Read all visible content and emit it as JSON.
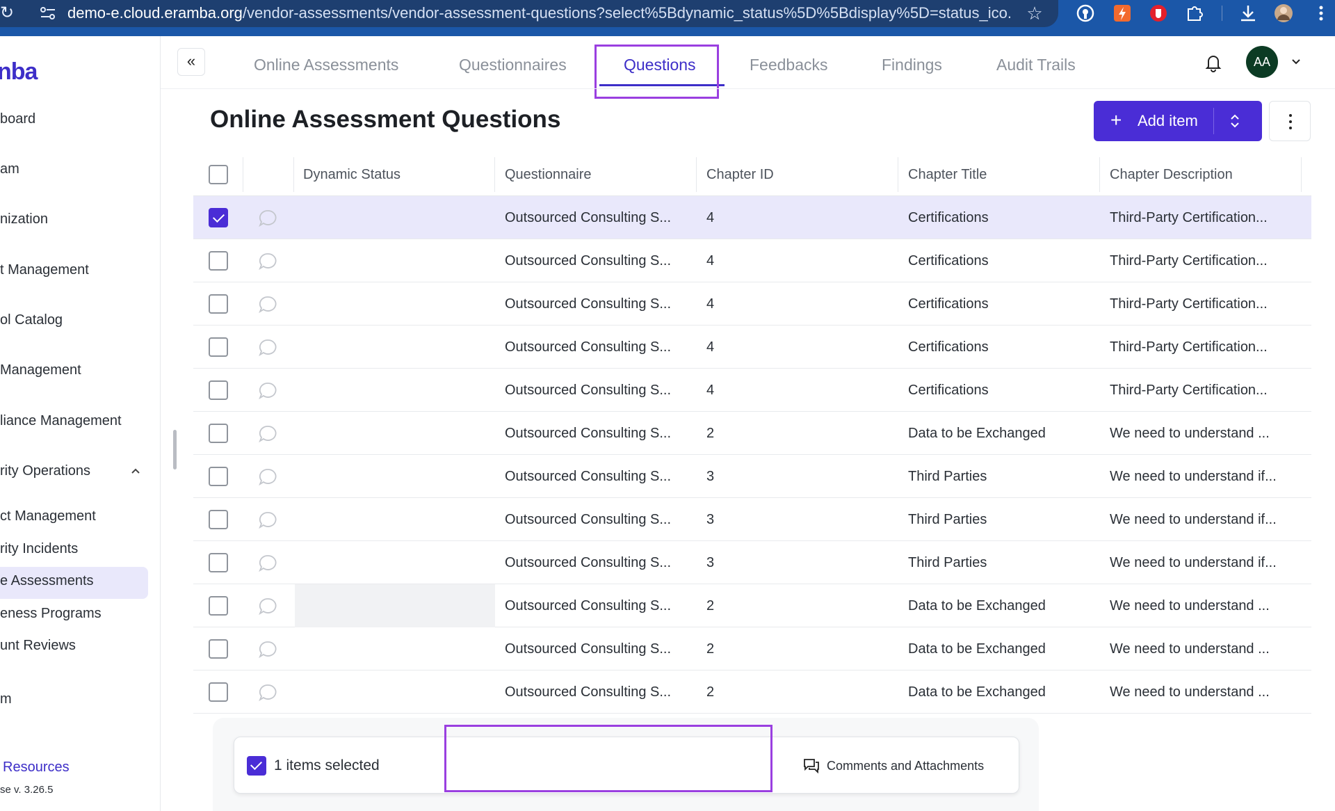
{
  "browser": {
    "url_host": "demo-e.cloud.eramba.org",
    "url_path": "/vendor-assessments/vendor-assessment-questions?select%5Bdynamic_status%5D%5Bdisplay%5D=status_ico..."
  },
  "sidebar": {
    "logo": "nba",
    "items": [
      {
        "label": "board"
      },
      {
        "label": "am"
      },
      {
        "label": "nization"
      },
      {
        "label": "t Management"
      },
      {
        "label": "ol Catalog"
      },
      {
        "label": "Management"
      },
      {
        "label": "liance Management"
      },
      {
        "label": "rity Operations"
      },
      {
        "label": "ct Management"
      },
      {
        "label": "rity Incidents"
      },
      {
        "label": "e Assessments"
      },
      {
        "label": "eness Programs"
      },
      {
        "label": "unt Reviews"
      },
      {
        "label": "m"
      }
    ],
    "resources": "Resources",
    "version": "se v. 3.26.5"
  },
  "tabs": [
    {
      "label": "Online Assessments"
    },
    {
      "label": "Questionnaires"
    },
    {
      "label": "Questions"
    },
    {
      "label": "Feedbacks"
    },
    {
      "label": "Findings"
    },
    {
      "label": "Audit Trails"
    }
  ],
  "header": {
    "collapse_glyph": "«",
    "avatar_initials": "AA"
  },
  "page": {
    "title": "Online Assessment Questions",
    "add_button": "Add item",
    "add_plus": "+"
  },
  "table": {
    "columns": [
      "Dynamic Status",
      "Questionnaire",
      "Chapter ID",
      "Chapter Title",
      "Chapter Description"
    ],
    "rows": [
      {
        "questionnaire": "Outsourced Consulting S...",
        "chapter_id": "4",
        "chapter_title": "Certifications",
        "chapter_description": "Third-Party Certification...",
        "checked": true
      },
      {
        "questionnaire": "Outsourced Consulting S...",
        "chapter_id": "4",
        "chapter_title": "Certifications",
        "chapter_description": "Third-Party Certification..."
      },
      {
        "questionnaire": "Outsourced Consulting S...",
        "chapter_id": "4",
        "chapter_title": "Certifications",
        "chapter_description": "Third-Party Certification..."
      },
      {
        "questionnaire": "Outsourced Consulting S...",
        "chapter_id": "4",
        "chapter_title": "Certifications",
        "chapter_description": "Third-Party Certification..."
      },
      {
        "questionnaire": "Outsourced Consulting S...",
        "chapter_id": "4",
        "chapter_title": "Certifications",
        "chapter_description": "Third-Party Certification..."
      },
      {
        "questionnaire": "Outsourced Consulting S...",
        "chapter_id": "2",
        "chapter_title": "Data to be Exchanged",
        "chapter_description": "We need to understand ..."
      },
      {
        "questionnaire": "Outsourced Consulting S...",
        "chapter_id": "3",
        "chapter_title": "Third Parties",
        "chapter_description": "We need to understand if..."
      },
      {
        "questionnaire": "Outsourced Consulting S...",
        "chapter_id": "3",
        "chapter_title": "Third Parties",
        "chapter_description": "We need to understand if..."
      },
      {
        "questionnaire": "Outsourced Consulting S...",
        "chapter_id": "3",
        "chapter_title": "Third Parties",
        "chapter_description": "We need to understand if..."
      },
      {
        "questionnaire": "Outsourced Consulting S...",
        "chapter_id": "2",
        "chapter_title": "Data to be Exchanged",
        "chapter_description": "We need to understand ..."
      },
      {
        "questionnaire": "Outsourced Consulting S...",
        "chapter_id": "2",
        "chapter_title": "Data to be Exchanged",
        "chapter_description": "We need to understand ..."
      },
      {
        "questionnaire": "Outsourced Consulting S...",
        "chapter_id": "2",
        "chapter_title": "Data to be Exchanged",
        "chapter_description": "We need to understand ..."
      }
    ]
  },
  "selection_bar": {
    "count_label": "1 items selected",
    "comments_label": "Comments and Attachments"
  },
  "colors": {
    "accent": "#4a2dd6",
    "annotation": "#9a3fe0",
    "browser": "#1b57a8"
  }
}
